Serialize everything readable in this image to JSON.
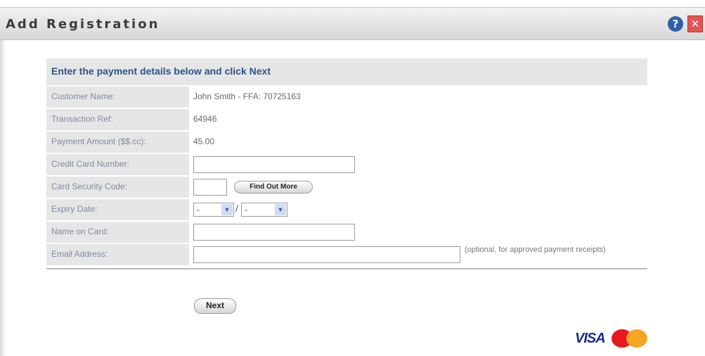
{
  "window": {
    "title": "Add Registration",
    "help_glyph": "?",
    "close_glyph": "✕"
  },
  "form": {
    "header": "Enter the payment details below and click Next",
    "customer_name_label": "Customer Name:",
    "customer_name_value": "John Smith - FFA: 70725163",
    "transaction_ref_label": "Transaction Ref:",
    "transaction_ref_value": "64946",
    "payment_amount_label": "Payment Amount ($$.cc):",
    "payment_amount_value": "45.00",
    "credit_card_label": "Credit Card Number:",
    "credit_card_value": "",
    "security_code_label": "Card Security Code:",
    "security_code_value": "",
    "find_out_more_label": "Find Out More",
    "expiry_label": "Expiry Date:",
    "expiry_month_selected": "-",
    "expiry_year_selected": "-",
    "expiry_separator": "/",
    "name_on_card_label": "Name on Card:",
    "name_on_card_value": "",
    "email_label": "Email Address:",
    "email_value": "",
    "email_hint": "(optional, for approved payment receipts)",
    "next_label": "Next"
  },
  "payment_logos": {
    "visa_text": "VISA",
    "mastercard_icon": "mastercard-logo"
  },
  "colors": {
    "header_text": "#2c5389",
    "label_bg": "#e6e6e6",
    "label_text": "#7d8ba0"
  }
}
